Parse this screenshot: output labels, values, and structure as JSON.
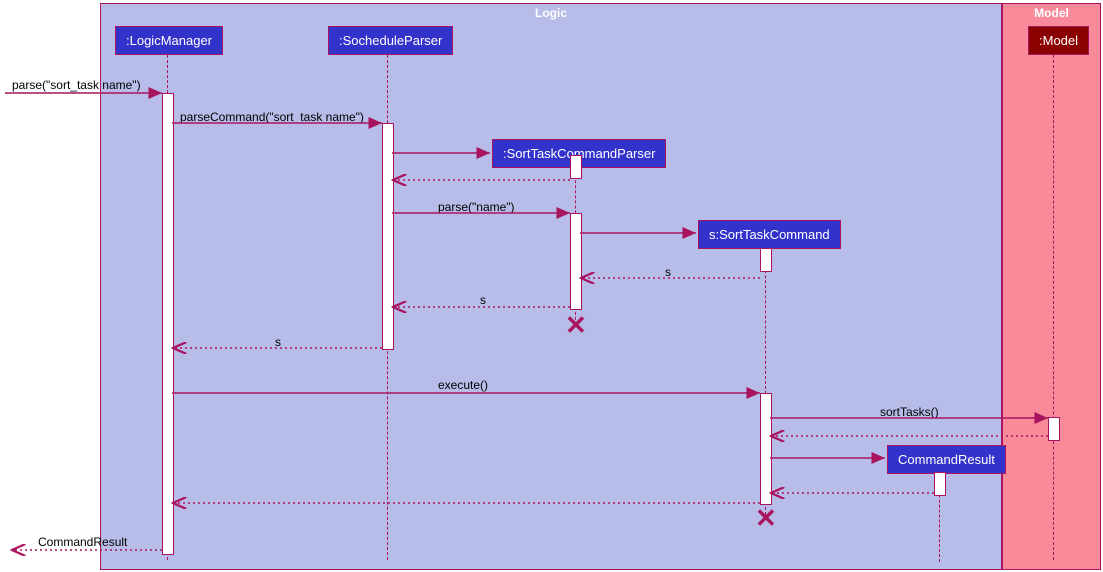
{
  "regions": {
    "logic_title": "Logic",
    "model_title": "Model"
  },
  "participants": {
    "logic_manager": ":LogicManager",
    "sochedule_parser": ":SocheduleParser",
    "sort_task_command_parser": ":SortTaskCommandParser",
    "sort_task_command": "s:SortTaskCommand",
    "command_result": "CommandResult",
    "model": ":Model"
  },
  "messages": {
    "m1": "parse(\"sort_task name\")",
    "m2": "parseCommand(\"sort_task name\")",
    "m3": "parse(\"name\")",
    "m4": "s",
    "m5": "s",
    "m6": "s",
    "m7": "execute()",
    "m8": "sortTasks()",
    "m9": "CommandResult"
  },
  "colors": {
    "line": "#a9145f",
    "logic_bg": "#b8bce8",
    "model_bg": "#f88a9a",
    "participant_bg": "#3333cc",
    "participant_model_bg": "#8b0000"
  }
}
